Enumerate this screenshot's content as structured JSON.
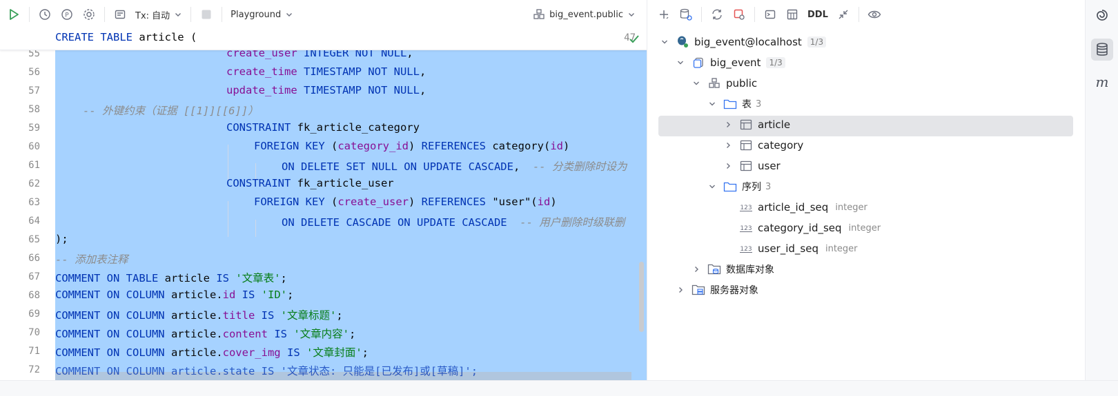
{
  "editor_toolbar": {
    "tx_label": "Tx: 自动",
    "console_label": "Playground",
    "schema_label": "big_event.public"
  },
  "editor": {
    "sticky": {
      "line_no": "47",
      "text_kw": "CREATE TABLE",
      "text_rest": " article ("
    },
    "line_numbers": [
      "55",
      "56",
      "57",
      "58",
      "59",
      "60",
      "61",
      "62",
      "63",
      "64",
      "65",
      "66",
      "67",
      "68",
      "69",
      "70",
      "71",
      "72"
    ],
    "lines": {
      "l55_a": "create_user",
      "l55_b": " INTEGER NOT NULL",
      "l55_c": ",",
      "l56_a": "create_time",
      "l56_b": " TIMESTAMP NOT NULL",
      "l56_c": ",",
      "l57_a": "update_time",
      "l57_b": " TIMESTAMP NOT NULL",
      "l57_c": ",",
      "l58": "-- 外键约束（证据 [[1]][[6]]）",
      "l59_a": "CONSTRAINT",
      "l59_b": " fk_article_category",
      "l60_a": "FOREIGN KEY",
      "l60_b": " (",
      "l60_c": "category_id",
      "l60_d": ") ",
      "l60_e": "REFERENCES",
      "l60_f": " category(",
      "l60_g": "id",
      "l60_h": ")",
      "l61_a": "ON DELETE SET NULL ON UPDATE CASCADE",
      "l61_b": ",  ",
      "l61_c": "-- 分类删除时设为",
      "l62_a": "CONSTRAINT",
      "l62_b": " fk_article_user",
      "l63_a": "FOREIGN KEY",
      "l63_b": " (",
      "l63_c": "create_user",
      "l63_d": ") ",
      "l63_e": "REFERENCES",
      "l63_f": " \"user\"(",
      "l63_g": "id",
      "l63_h": ")",
      "l64_a": "ON DELETE CASCADE ON UPDATE CASCADE",
      "l64_b": "  ",
      "l64_c": "-- 用户删除时级联删",
      "l65": ");",
      "l66": "-- 添加表注释",
      "l67_a": "COMMENT ON TABLE",
      "l67_b": " article ",
      "l67_c": "IS",
      "l67_d": " ",
      "l67_e": "'文章表'",
      "l67_f": ";",
      "l68_a": "COMMENT ON COLUMN",
      "l68_b": " article.",
      "l68_c": "id",
      "l68_d": " ",
      "l68_e": "IS",
      "l68_f": " ",
      "l68_g": "'ID'",
      "l68_h": ";",
      "l69_a": "COMMENT ON COLUMN",
      "l69_b": " article.",
      "l69_c": "title",
      "l69_d": " ",
      "l69_e": "IS",
      "l69_f": " ",
      "l69_g": "'文章标题'",
      "l69_h": ";",
      "l70_a": "COMMENT ON COLUMN",
      "l70_b": " article.",
      "l70_c": "content",
      "l70_d": " ",
      "l70_e": "IS",
      "l70_f": " ",
      "l70_g": "'文章内容'",
      "l70_h": ";",
      "l71_a": "COMMENT ON COLUMN",
      "l71_b": " article.",
      "l71_c": "cover_img",
      "l71_d": " ",
      "l71_e": "IS",
      "l71_f": " ",
      "l71_g": "'文章封面'",
      "l71_h": ";",
      "l72": "COMMENT ON COLUMN article.state IS '文章状态: 只能是[已发布]或[草稿]';"
    }
  },
  "db_toolbar": {
    "ddl_label": "DDL"
  },
  "tree": {
    "connection": {
      "label": "big_event@localhost",
      "badge": "1/3"
    },
    "database": {
      "label": "big_event",
      "badge": "1/3"
    },
    "schema": {
      "label": "public"
    },
    "tables_folder": {
      "label": "表",
      "count": "3"
    },
    "tables": [
      "article",
      "category",
      "user"
    ],
    "sequences_folder": {
      "label": "序列",
      "count": "3"
    },
    "sequences": [
      {
        "name": "article_id_seq",
        "type": "integer"
      },
      {
        "name": "category_id_seq",
        "type": "integer"
      },
      {
        "name": "user_id_seq",
        "type": "integer"
      }
    ],
    "db_objects": {
      "label": "数据库对象"
    },
    "server_objects": {
      "label": "服务器对象"
    }
  },
  "colors": {
    "keyword": "#0033b3",
    "field": "#871094",
    "string": "#067d17",
    "comment": "#8c8c8c",
    "selection": "#a6d2ff",
    "run_green": "#3aa05a",
    "tree_selected": "#e4e5e8"
  }
}
